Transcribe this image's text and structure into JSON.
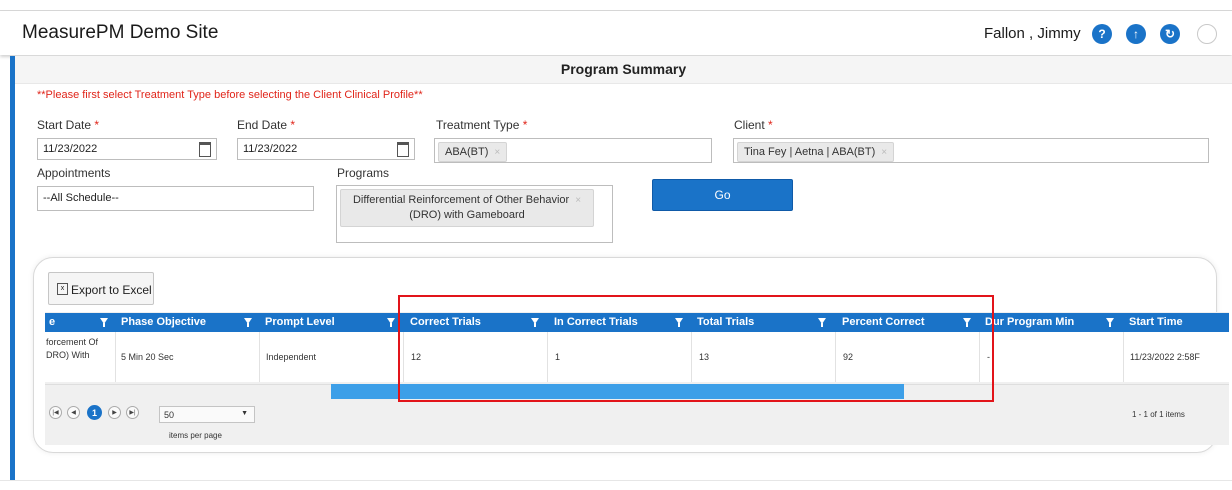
{
  "header": {
    "site_title": "MeasurePM Demo Site",
    "user_name": "Fallon , Jimmy",
    "icons": [
      "help-icon",
      "upload-icon",
      "refresh-icon",
      "avatar-icon"
    ]
  },
  "panel": {
    "title": "Program Summary",
    "warning": "**Please first select Treatment Type before selecting the Client Clinical Profile**",
    "start_date": {
      "label": "Start Date",
      "required": "*",
      "value": "11/23/2022"
    },
    "end_date": {
      "label": "End Date",
      "required": "*",
      "value": "11/23/2022"
    },
    "treatment_type": {
      "label": "Treatment Type",
      "required": "*",
      "chip": "ABA(BT)",
      "chip_x": "×"
    },
    "client": {
      "label": "Client",
      "required": "*",
      "chip": "Tina Fey | Aetna | ABA(BT)",
      "chip_x": "×"
    },
    "appointments": {
      "label": "Appointments",
      "value": "--All Schedule--"
    },
    "programs": {
      "label": "Programs",
      "chip_line1": "Differential Reinforcement of Other Behavior",
      "chip_line2": "(DRO) with Gameboard",
      "chip_x": "×"
    },
    "go_label": "Go"
  },
  "grid": {
    "export_label": "Export to Excel",
    "columns": [
      "e",
      "Phase Objective",
      "Prompt Level",
      "Correct Trials",
      "In Correct Trials",
      "Total Trials",
      "Percent Correct",
      "Dur Program Min",
      "Start Time"
    ],
    "row": {
      "program_line1": "forcement Of",
      "program_line2": "DRO) With",
      "phase_objective": "5 Min 20 Sec",
      "prompt_level": "Independent",
      "correct_trials": "12",
      "incorrect_trials": "1",
      "total_trials": "13",
      "percent_correct": "92",
      "dur_program_min": "-",
      "start_time": "11/23/2022 2:58F"
    },
    "pager": {
      "first": "|◀",
      "prev": "◀",
      "current_page": "1",
      "next": "▶",
      "last": "▶|",
      "page_size": "50",
      "items_per_page": "items per page",
      "count": "1 - 1 of 1 items"
    },
    "scroll_fraction": 0.48
  },
  "colors": {
    "accent": "#1a73c8",
    "warning": "#e0251a",
    "highlight_box": "#e2141a",
    "scroll_thumb": "#3d9fe8"
  }
}
